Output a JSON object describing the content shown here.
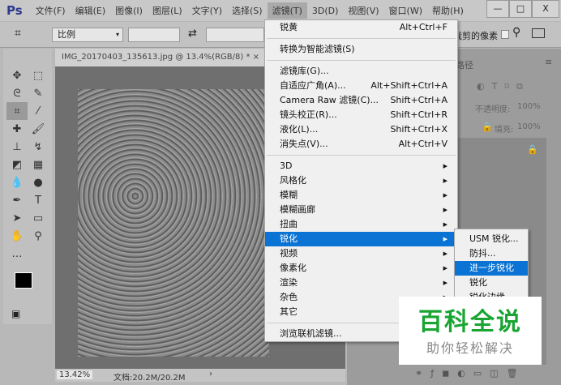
{
  "app": {
    "logo": "Ps"
  },
  "menubar": [
    "文件(F)",
    "编辑(E)",
    "图像(I)",
    "图层(L)",
    "文字(Y)",
    "选择(S)",
    "滤镜(T)",
    "3D(D)",
    "视图(V)",
    "窗口(W)",
    "帮助(H)"
  ],
  "window": {
    "minimize": "—",
    "maximize": "□",
    "close": "X"
  },
  "options": {
    "ratio": "比例",
    "right_text": "删除裁剪的像素"
  },
  "document": {
    "tab": "IMG_20170403_135613.jpg @ 13.4%(RGB/8) *",
    "close": "×",
    "zoom": "13.42%",
    "doc_size": "文档:20.2M/20.2M",
    "arrow": "›"
  },
  "panel": {
    "tab": "路径",
    "opacity_label": "不透明度:",
    "opacity": "100%",
    "fill_label": "填充:",
    "fill": "100%"
  },
  "filter_menu": {
    "top": [
      {
        "label": "锐黄",
        "shortcut": "Alt+Ctrl+F"
      }
    ],
    "smart": [
      {
        "label": "转换为智能滤镜(S)"
      }
    ],
    "group1": [
      {
        "label": "滤镜库(G)...",
        "shortcut": ""
      },
      {
        "label": "自适应广角(A)...",
        "shortcut": "Alt+Shift+Ctrl+A"
      },
      {
        "label": "Camera Raw 滤镜(C)...",
        "shortcut": "Shift+Ctrl+A"
      },
      {
        "label": "镜头校正(R)...",
        "shortcut": "Shift+Ctrl+R"
      },
      {
        "label": "液化(L)...",
        "shortcut": "Shift+Ctrl+X"
      },
      {
        "label": "消失点(V)...",
        "shortcut": "Alt+Ctrl+V"
      }
    ],
    "group2": [
      "3D",
      "风格化",
      "模糊",
      "模糊画廊",
      "扭曲",
      "锐化",
      "视频",
      "像素化",
      "渲染",
      "杂色",
      "其它"
    ],
    "browse": "浏览联机滤镜..."
  },
  "sharpen_submenu": [
    "USM 锐化...",
    "防抖...",
    "进一步锐化",
    "锐化",
    "锐化边缘"
  ],
  "watermark": {
    "title": "百科全说",
    "subtitle": "助你轻松解决"
  }
}
